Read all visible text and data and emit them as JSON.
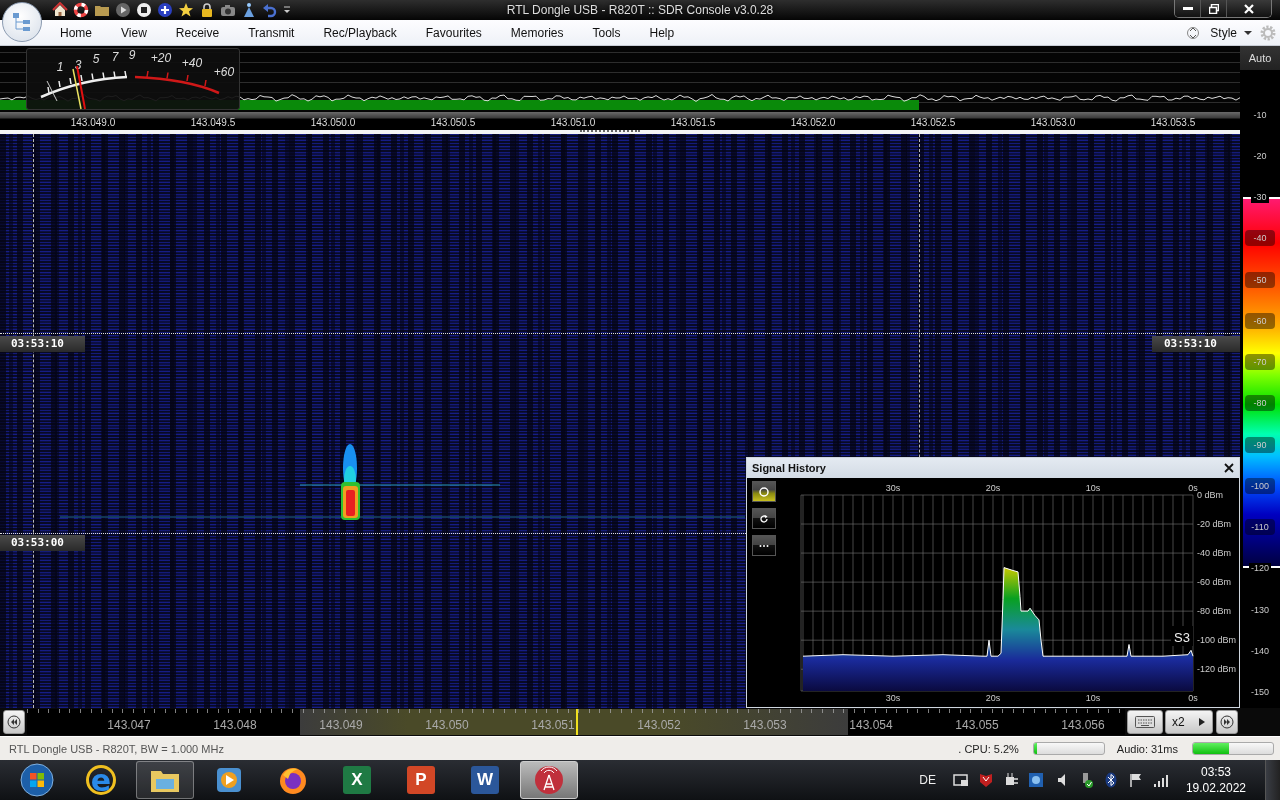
{
  "window": {
    "title": "RTL Dongle USB - R820T :: SDR Console v3.0.28"
  },
  "menu": [
    "Home",
    "View",
    "Receive",
    "Transmit",
    "Rec/Playback",
    "Favourites",
    "Memories",
    "Tools",
    "Help"
  ],
  "style_menu": "Style",
  "spectrum": {
    "auto_label": "Auto",
    "frequency_labels": [
      "143.049.0",
      "143.049.5",
      "143.050.0",
      "143.050.5",
      "143.051.0",
      "143.051.5",
      "143.052.0",
      "143.052.5",
      "143.053.0",
      "143.053.5"
    ],
    "s_meter": {
      "scale_labels": [
        "1",
        "3",
        "5",
        "7",
        "9",
        "+20",
        "+40",
        "+60"
      ]
    }
  },
  "waterfall": {
    "time_markers": [
      {
        "left": "03:53:10",
        "right": "03:53:10"
      },
      {
        "left": "03:53:00"
      }
    ]
  },
  "db_scale": {
    "labels": [
      "-10",
      "-20",
      "-30",
      "-40",
      "-50",
      "-60",
      "-70",
      "-80",
      "-90",
      "-100",
      "-110",
      "-120",
      "-130",
      "-140",
      "-150"
    ]
  },
  "signal_history": {
    "title": "Signal History",
    "tools": [
      {
        "kind": "circle",
        "selected": true
      },
      {
        "kind": "refresh",
        "selected": false
      },
      {
        "kind": "more",
        "selected": false
      }
    ],
    "top_axis_labels": [
      "30s",
      "20s",
      "10s",
      "0s"
    ],
    "s_reading": "S3",
    "chart_data": {
      "type": "line",
      "grid": true,
      "x": [
        39,
        35,
        30,
        25,
        21,
        20.6,
        20.4,
        20.2,
        19.5,
        19.2,
        19.0,
        18.9,
        18.0,
        17.5,
        17.3,
        17.2,
        16.5,
        16.3,
        15.8,
        15.4,
        15.2,
        15.0,
        14.5,
        10,
        7,
        6.6,
        6.4,
        6.2,
        3,
        0.5,
        0.2,
        0
      ],
      "series": [
        {
          "color": "#ffffff",
          "values": [
            -111,
            -110,
            -111,
            -110,
            -111,
            -111,
            -100,
            -111,
            -111,
            -109,
            -72,
            -50,
            -52,
            -53,
            -70,
            -80,
            -80,
            -78,
            -83,
            -86,
            -100,
            -111,
            -111,
            -111,
            -111,
            -111,
            -103,
            -111,
            -111,
            -110,
            -107,
            -111
          ]
        }
      ],
      "xlim": [
        39.2,
        0
      ],
      "ylim": [
        -135,
        0
      ],
      "xticks": [
        {
          "value": 30,
          "label": "30s"
        },
        {
          "value": 20,
          "label": "20s"
        },
        {
          "value": 10,
          "label": "10s"
        },
        {
          "value": 0,
          "label": "0s"
        }
      ],
      "yticks": [
        {
          "value": 0,
          "label": "0 dBm"
        },
        {
          "value": -20,
          "label": "-20 dBm"
        },
        {
          "value": -40,
          "label": "-40 dBm"
        },
        {
          "value": -60,
          "label": "-60 dBm"
        },
        {
          "value": -80,
          "label": "-80 dBm"
        },
        {
          "value": -100,
          "label": "-100 dBm"
        },
        {
          "value": -120,
          "label": "-120 dBm"
        }
      ]
    }
  },
  "tuning_bar": {
    "frequency_labels": [
      "143.047",
      "143.048",
      "143.049",
      "143.050",
      "143.051",
      "143.052",
      "143.053",
      "143.054",
      "143.055",
      "143.056"
    ],
    "zoom": "x2"
  },
  "status_bar": {
    "text": "RTL Dongle USB - R820T, BW = 1.000 MHz",
    "cpu": {
      "label": ". CPU: 5.2%",
      "level": 0.04
    },
    "audio": {
      "label": "Audio: 31ms",
      "level": 0.45
    }
  },
  "taskbar": {
    "apps": [
      {
        "kind": "start",
        "running": false,
        "selected": false
      },
      {
        "kind": "ie",
        "glyph": "e",
        "running": false,
        "selected": false
      },
      {
        "kind": "explorer",
        "running": true,
        "selected": false
      },
      {
        "kind": "media",
        "running": false,
        "selected": false
      },
      {
        "kind": "firefox",
        "running": false,
        "selected": false
      },
      {
        "kind": "excel",
        "glyph": "X",
        "running": false,
        "selected": false
      },
      {
        "kind": "powerpoint",
        "glyph": "P",
        "running": false,
        "selected": false
      },
      {
        "kind": "word",
        "glyph": "W",
        "running": false,
        "selected": false
      },
      {
        "kind": "sdr",
        "running": true,
        "selected": true
      }
    ],
    "language": "DE",
    "time": "03:53",
    "date": "19.02.2022"
  }
}
